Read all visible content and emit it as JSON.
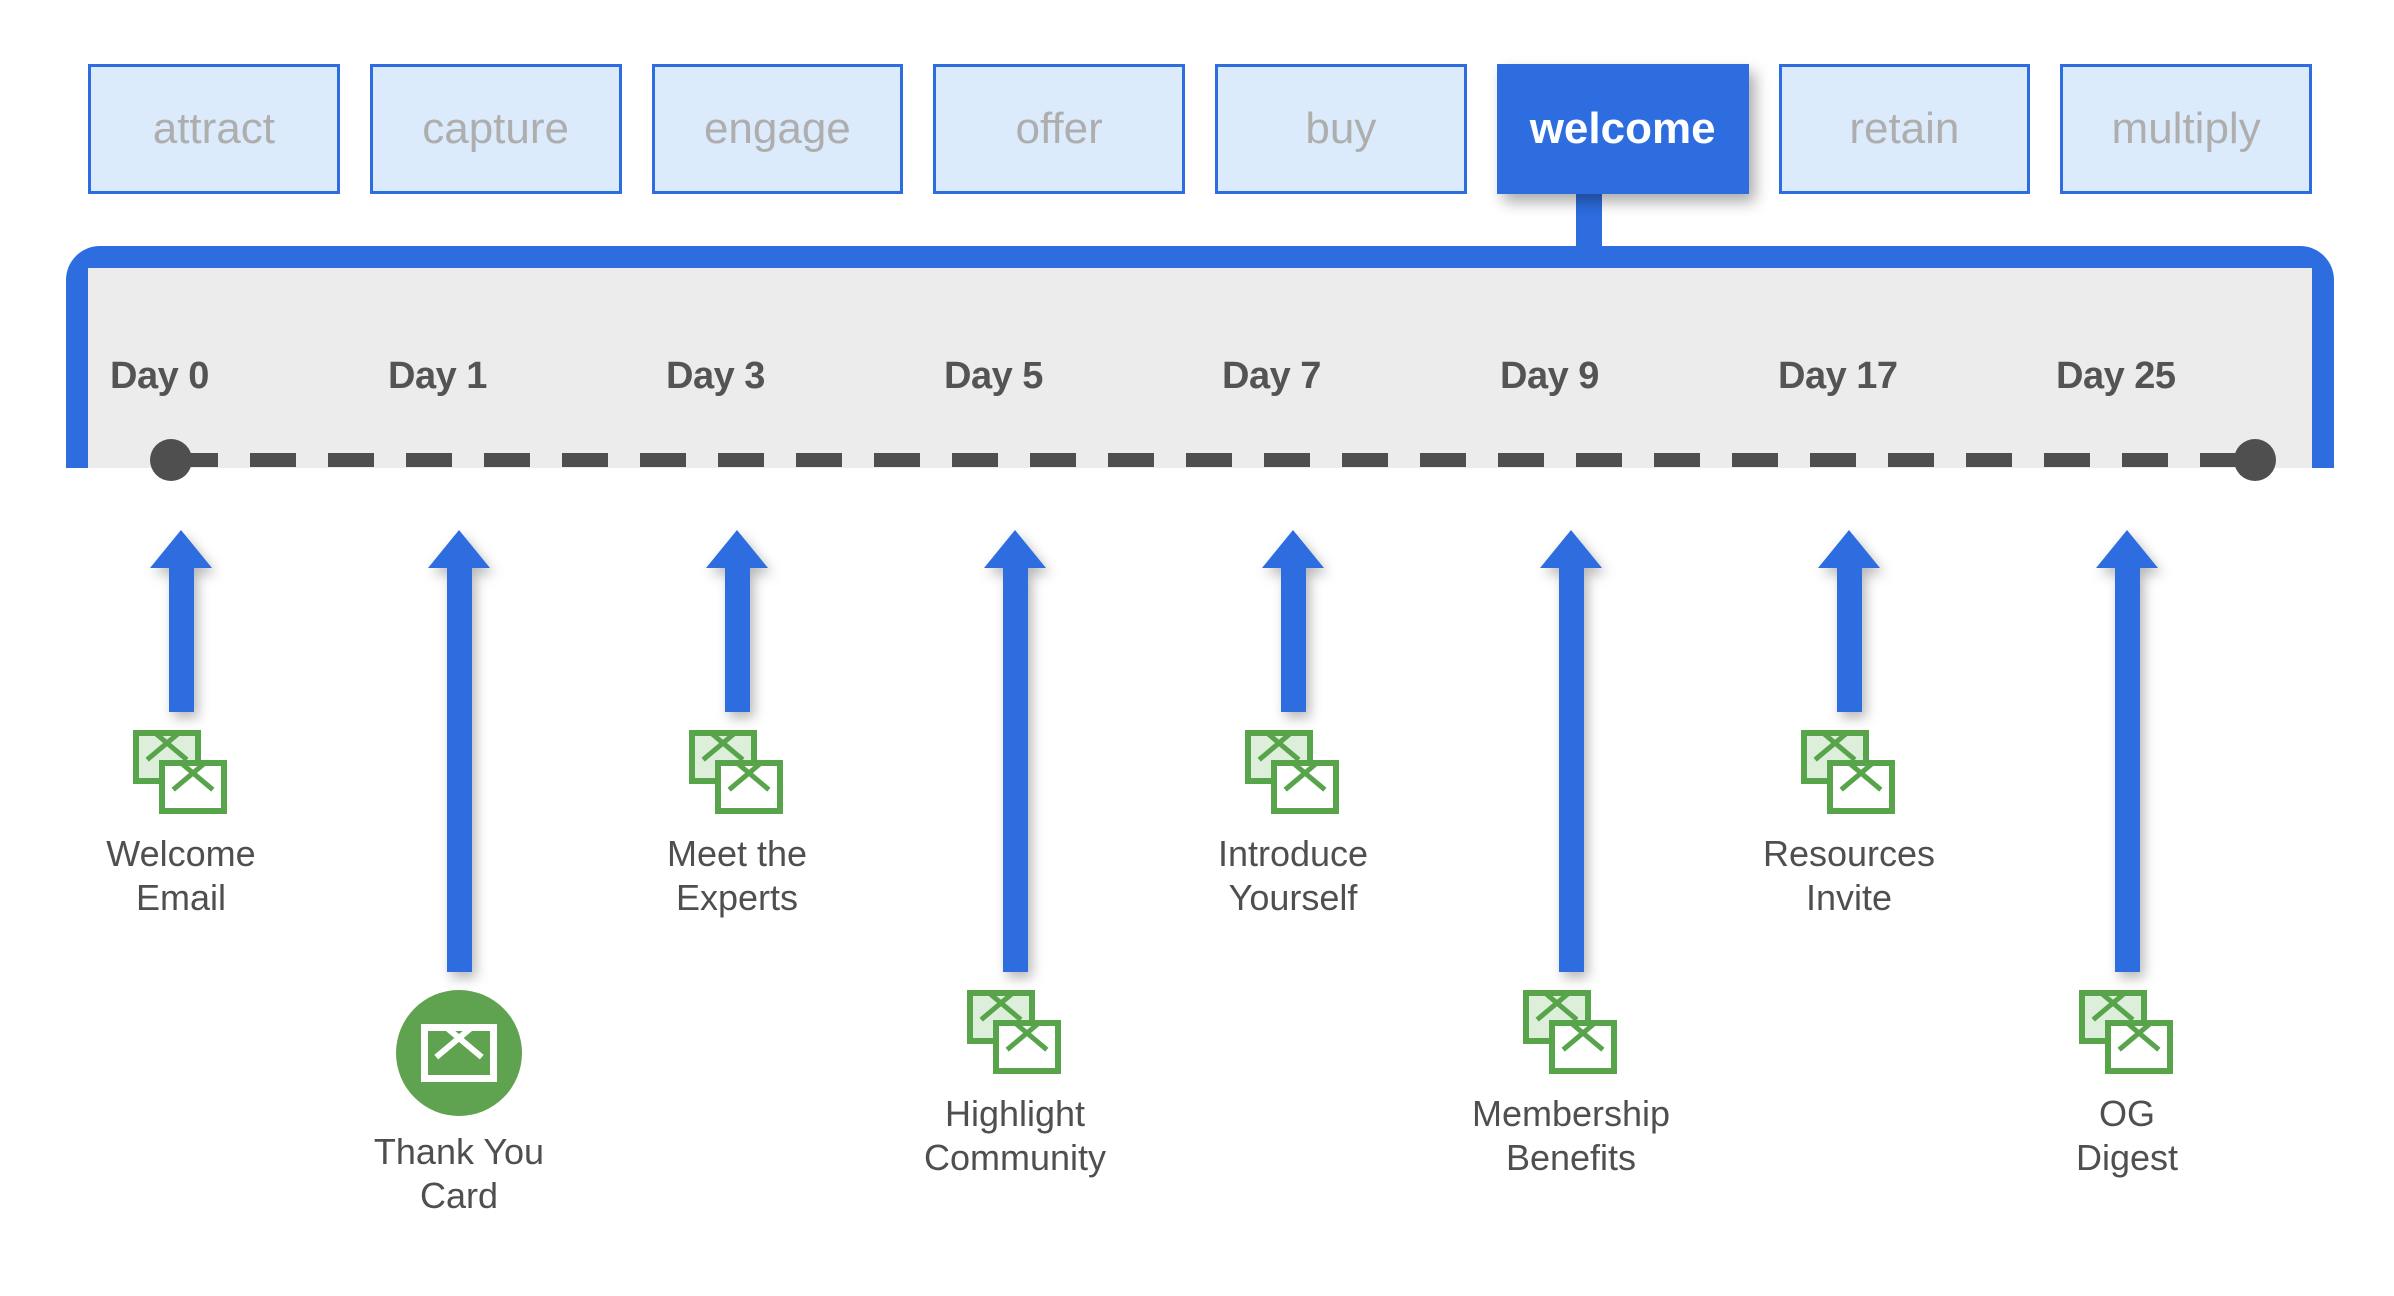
{
  "stages": {
    "items": [
      {
        "label": "attract",
        "active": false
      },
      {
        "label": "capture",
        "active": false
      },
      {
        "label": "engage",
        "active": false
      },
      {
        "label": "offer",
        "active": false
      },
      {
        "label": "buy",
        "active": false
      },
      {
        "label": "welcome",
        "active": true
      },
      {
        "label": "retain",
        "active": false
      },
      {
        "label": "multiply",
        "active": false
      }
    ],
    "active_label": "welcome"
  },
  "timeline": {
    "days": [
      "Day 0",
      "Day 1",
      "Day 3",
      "Day 5",
      "Day 7",
      "Day 9",
      "Day 17",
      "Day 25"
    ],
    "line_style": "dashed",
    "start_marker": "dot",
    "end_marker": "dot"
  },
  "touchpoints": [
    {
      "day": "Day 0",
      "label": "Welcome\nEmail",
      "icon": "double-envelope-icon",
      "row": "top",
      "arrow": "short"
    },
    {
      "day": "Day 1",
      "label": "Thank You\nCard",
      "icon": "circle-envelope-icon",
      "row": "bottom",
      "arrow": "long"
    },
    {
      "day": "Day 3",
      "label": "Meet the\nExperts",
      "icon": "double-envelope-icon",
      "row": "top",
      "arrow": "short"
    },
    {
      "day": "Day 5",
      "label": "Highlight\nCommunity",
      "icon": "double-envelope-icon",
      "row": "bottom",
      "arrow": "long"
    },
    {
      "day": "Day 7",
      "label": "Introduce\nYourself",
      "icon": "double-envelope-icon",
      "row": "top",
      "arrow": "short"
    },
    {
      "day": "Day 9",
      "label": "Membership\nBenefits",
      "icon": "double-envelope-icon",
      "row": "bottom",
      "arrow": "long"
    },
    {
      "day": "Day 17",
      "label": "Resources\nInvite",
      "icon": "double-envelope-icon",
      "row": "top",
      "arrow": "short"
    },
    {
      "day": "Day 25",
      "label": "OG\nDigest",
      "icon": "double-envelope-icon",
      "row": "bottom",
      "arrow": "long"
    }
  ],
  "colors": {
    "brand_blue": "#2D6DE0",
    "tab_fill": "#DCEBFB",
    "tab_text": "#AEAEAE",
    "timeline_fill": "#ECECEC",
    "line_gray": "#4F4F4F",
    "envelope_green": "#57A44B",
    "envelope_green_fill": "#DDEEDA",
    "circle_green": "#5FA24F"
  }
}
